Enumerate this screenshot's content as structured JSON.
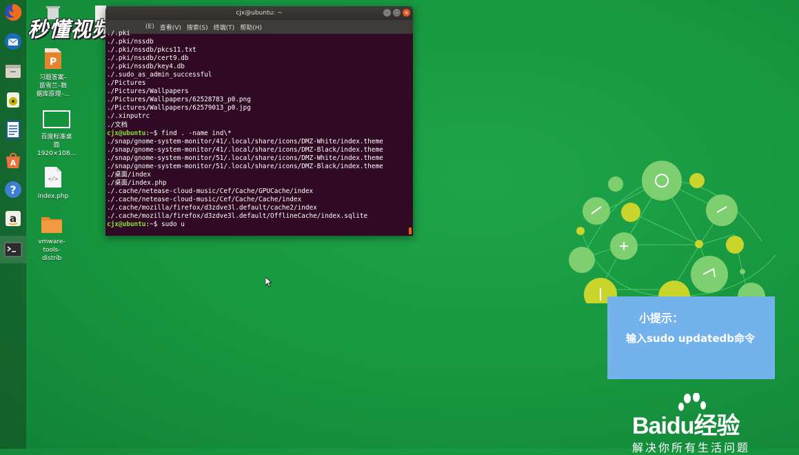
{
  "watermark": "秒懂视频",
  "launcher": {
    "items": [
      "firefox",
      "thunderbird",
      "files",
      "rhythmbox",
      "libreoffice-writer",
      "software-center",
      "help",
      "amazon",
      "terminal"
    ]
  },
  "desktop": {
    "icons": [
      {
        "label": "习题答案–苗雪兰–数据库原理–...",
        "lines": [
          "习题答案–",
          "苗雪兰–数",
          "据库原理–..."
        ]
      },
      {
        "label": "百度标准桌面1920×108...",
        "lines": [
          "百度标准桌",
          "面",
          "1920×108..."
        ]
      },
      {
        "label": "index.php",
        "lines": [
          "index.php"
        ]
      },
      {
        "label": "vmware-tools-distrib",
        "lines": [
          "vmware-",
          "tools-",
          "distrib"
        ]
      }
    ]
  },
  "terminal": {
    "title": "cjx@ubuntu: ~",
    "menu": [
      "(E)",
      "查看(V)",
      "搜索(S)",
      "终端(T)",
      "帮助(H)"
    ],
    "lines": [
      {
        "t": "./.pki"
      },
      {
        "t": "./.pki/nssdb"
      },
      {
        "t": "./.pki/nssdb/pkcs11.txt"
      },
      {
        "t": "./.pki/nssdb/cert9.db"
      },
      {
        "t": "./.pki/nssdb/key4.db"
      },
      {
        "t": "./.sudo_as_admin_successful"
      },
      {
        "t": "./Pictures"
      },
      {
        "t": "./Pictures/Wallpapers"
      },
      {
        "t": "./Pictures/Wallpapers/62528783_p0.png"
      },
      {
        "t": "./Pictures/Wallpapers/62579013_p0.jpg"
      },
      {
        "t": "./.xinputrc"
      },
      {
        "t": "./文档"
      },
      {
        "p": "cjx@ubuntu",
        "t": ":~$ find . -name ind\\*"
      },
      {
        "t": "./snap/gnome-system-monitor/41/.local/share/icons/DMZ-White/index.theme"
      },
      {
        "t": "./snap/gnome-system-monitor/41/.local/share/icons/DMZ-Black/index.theme"
      },
      {
        "t": "./snap/gnome-system-monitor/51/.local/share/icons/DMZ-White/index.theme"
      },
      {
        "t": "./snap/gnome-system-monitor/51/.local/share/icons/DMZ-Black/index.theme"
      },
      {
        "t": "./桌面/index"
      },
      {
        "t": "./桌面/index.php"
      },
      {
        "t": "./.cache/netease-cloud-music/Cef/Cache/GPUCache/index"
      },
      {
        "t": "./.cache/netease-cloud-music/Cef/Cache/Cache/index"
      },
      {
        "t": "./.cache/mozilla/firefox/d3zdve3l.default/cache2/index"
      },
      {
        "t": "./.cache/mozilla/firefox/d3zdve3l.default/OfflineCache/index.sqlite"
      },
      {
        "p": "cjx@ubuntu",
        "t": ":~$ sudo u"
      }
    ]
  },
  "tip": {
    "title": "小提示：",
    "text": "输入sudo updatedb命令"
  },
  "brand": {
    "logo": "Baidu经验",
    "slogan": "解决你所有生活问题"
  },
  "colors": {
    "desktop_bg": "#17963f",
    "terminal_bg": "#300a24",
    "prompt": "#8ae234",
    "tip_bg": "#74b2ec"
  }
}
